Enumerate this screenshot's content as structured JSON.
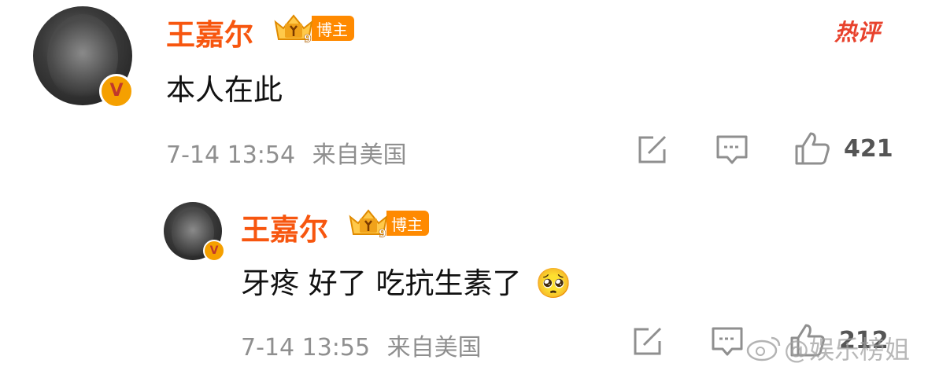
{
  "main_comment": {
    "username": "王嘉尔",
    "badge": "博主",
    "badge_level": "9",
    "hot_label": "热评",
    "text": "本人在此",
    "timestamp": "7-14 13:54",
    "location": "来自美国",
    "like_count": "421",
    "verified_mark": "V"
  },
  "reply": {
    "username": "王嘉尔",
    "badge": "博主",
    "badge_level": "9",
    "text": "牙疼 好了 吃抗生素了",
    "emoji": "🥺",
    "timestamp": "7-14 13:55",
    "location": "来自美国",
    "like_count": "212",
    "verified_mark": "V"
  },
  "watermark": "@娱乐榜姐",
  "icons": [
    "share-icon",
    "comment-icon",
    "like-icon",
    "crown-badge-icon",
    "verified-icon",
    "weibo-logo-icon"
  ],
  "colors": {
    "username": "#f7560f",
    "badge": "#ff8a00",
    "hot": "#e8422d",
    "meta": "#8f8f8f"
  }
}
